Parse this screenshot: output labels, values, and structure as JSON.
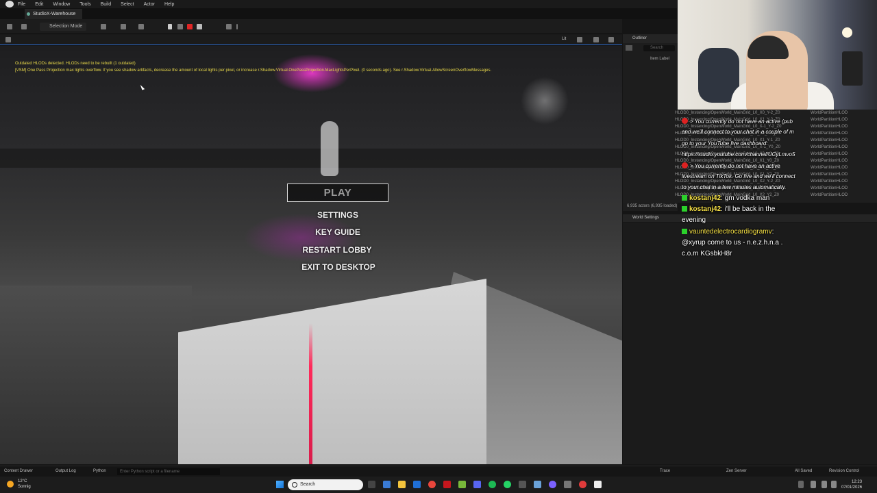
{
  "menubar": {
    "items": [
      "File",
      "Edit",
      "Window",
      "Tools",
      "Build",
      "Select",
      "Actor",
      "Help"
    ]
  },
  "tab": {
    "title": "StudioX-Warehouse"
  },
  "toolbar": {
    "selection_mode": "Selection Mode"
  },
  "viewport_bar": {
    "lit": "Lit"
  },
  "viewport": {
    "warning1": "Outdated HLODs detected. HLODs need to be rebuilt (1 outdated)",
    "warning2": "[VSM] One Pass Projection max lights overflow. If you see shadow artifacts, decrease the amount of local lights per pixel, or increase r.Shadow.Virtual.OnePassProjection.MaxLightsPerPixel. (0 seconds ago). See r.Shadow.Virtual.AllowScreenOverflowMessages."
  },
  "game_menu": {
    "play": "PLAY",
    "settings": "SETTINGS",
    "key_guide": "KEY GUIDE",
    "restart_lobby": "RESTART LOBBY",
    "exit": "EXIT TO DESKTOP"
  },
  "outliner": {
    "title": "Outliner",
    "search": "Search",
    "column": "Item Label"
  },
  "actor_rows": [
    {
      "label": "HLOD0_Instancing/OpenWorld_MainGrid_L0_X0_Y-2_Z0",
      "type": "WorldPartitionHLOD"
    },
    {
      "label": "HLOD0_Instancing/OpenWorld_MainGrid_L0_X1_Y-2_Z0",
      "type": "WorldPartitionHLOD"
    },
    {
      "label": "HLOD0_Instancing/OpenWorld_MainGrid_L0_X-1_Y-2_Z0",
      "type": "WorldPartitionHLOD"
    },
    {
      "label": "HLOD0_Instancing/OpenWorld_MainGrid_L0_X0_Y-1_Z0",
      "type": "WorldPartitionHLOD"
    },
    {
      "label": "HLOD0_Instancing/OpenWorld_MainGrid_L0_X1_Y-1_Z0",
      "type": "WorldPartitionHLOD"
    },
    {
      "label": "HLOD0_Instancing/OpenWorld_MainGrid_L0_X-1_Y0_Z0",
      "type": "WorldPartitionHLOD"
    },
    {
      "label": "HLOD0_Instancing/OpenWorld_MainGrid_L0_X0_Y0_Z0",
      "type": "WorldPartitionHLOD"
    },
    {
      "label": "HLOD0_Instancing/OpenWorld_MainGrid_L0_X1_Y0_Z0",
      "type": "WorldPartitionHLOD"
    },
    {
      "label": "HLOD0_Instancing/OpenWorld_MainGrid_L0_X-1_Y1_Z0",
      "type": "WorldPartitionHLOD"
    },
    {
      "label": "HLOD0_Instancing/OpenWorld_MainGrid_L0_X1_Y2_Z0",
      "type": "WorldPartitionHLOD"
    },
    {
      "label": "HLOD0_Instancing/OpenWorld_MainGrid_L0_X2_Y-2_Z0",
      "type": "WorldPartitionHLOD"
    },
    {
      "label": "HLOD0_Instancing/OpenWorld_MainGrid_L0_X2_Y-1_Z0",
      "type": "WorldPartitionHLOD"
    },
    {
      "label": "HLOD0_Instancing/OpenWorld_MainGrid_L0_X2_Y2_Z0",
      "type": "WorldPartitionHLOD"
    }
  ],
  "actor_count": "6,935 actors (6,935 loaded)",
  "world_settings": "World Settings",
  "chat": {
    "sys1": "> You currently do not have an active (pub",
    "sys1b": "and we'll connect to your chat in a couple of m",
    "sys2": "go to your YouTube live dashboard:",
    "sys3": "https://studio.youtube.com/channel/UCyLmvo5",
    "sys4": "> You currently do not have an active",
    "sys5": "livestream on TikTok. Go live and we'll connect",
    "sys6": "to your chat in a few minutes automatically.",
    "msg1_user": "kostanj42",
    "msg1_text": ": gm vodka man",
    "msg2_user": "kostanj42",
    "msg2_text": ": i'll be back in the",
    "msg2_cont": "evening",
    "msg3_user": "vauntedelectrocardiogramv",
    "msg3_text": ":",
    "msg3_cont1": "@xyrup come to us - n.e.z.h.n.a .",
    "msg3_cont2": "c.o.m KGsbkH8r"
  },
  "statusbar": {
    "content_drawer": "Content Drawer",
    "output_log": "Output Log",
    "python": "Python",
    "cmd_placeholder": "Enter Python script or a filename",
    "trace": "Trace",
    "zen": "Zen Server",
    "saved": "All Saved",
    "revision": "Revision Control"
  },
  "taskbar": {
    "temp": "12°C",
    "weather": "Sonnig",
    "search": "Search",
    "time": "12:23",
    "date": "07/01/2026"
  },
  "colors": {
    "accent": "#2e6fd4",
    "warning": "#e8d84a",
    "chat_user": "#f5e046",
    "laser": "#ff2a5a"
  }
}
